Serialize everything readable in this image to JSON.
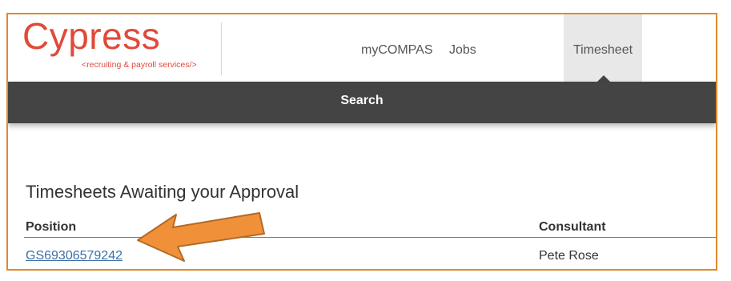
{
  "brand": {
    "name": "Cypress",
    "tagline_open": "<",
    "tagline": "recruiting & payroll services",
    "tagline_close": "/>",
    "color": "#e04a3a"
  },
  "nav": {
    "items": [
      {
        "label": "myCOMPAS"
      },
      {
        "label": "Jobs"
      }
    ],
    "active": {
      "label": "Timesheet"
    }
  },
  "subnav": {
    "search_label": "Search"
  },
  "section": {
    "title": "Timesheets Awaiting your Approval"
  },
  "table": {
    "columns": [
      "Position",
      "Consultant"
    ],
    "rows": [
      {
        "position": "GS69306579242",
        "consultant": "Pete Rose"
      }
    ]
  },
  "annotation": {
    "arrow_color": "#f0913a",
    "arrow_icon": "arrow-left-icon"
  },
  "colors": {
    "frame_border": "#e08a2e",
    "toolbar": "#444444",
    "link": "#3b6fa8"
  }
}
